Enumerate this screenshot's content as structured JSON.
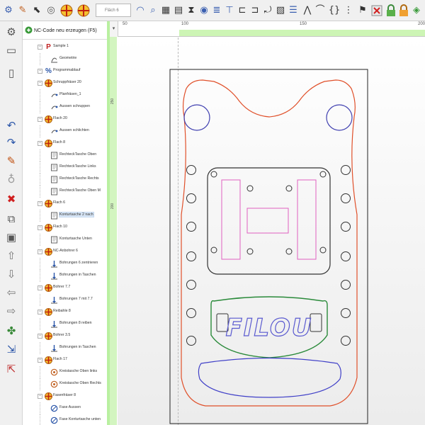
{
  "toolbar": {
    "tool_select_value": "Fläch 6",
    "icons": [
      "gear-magnet-icon",
      "text-edit-icon",
      "cursor-icon",
      "target-icon",
      "origin-cross-icon",
      "tool-select",
      "circle-arc-icon",
      "zoom-icon",
      "grid-icon",
      "pocket-icon",
      "cut-icon",
      "spiral-icon",
      "line-icon",
      "tool-probe-icon",
      "profile-icon",
      "magnet-icon",
      "bend-icon",
      "align-icon",
      "arc-icon",
      "brace-icon",
      "chess-flag-icon",
      "close-cross-icon",
      "lock-green-icon",
      "lock-orange-icon",
      "drop-icon"
    ]
  },
  "tree": {
    "title": "NC-Code neu erzeugen (F5)",
    "rows": [
      {
        "level": 0,
        "icon": "program-icon",
        "label": "Sample 1"
      },
      {
        "level": 1,
        "icon": "geometry-icon",
        "label": "Geometrie"
      },
      {
        "level": 0,
        "icon": "percent-icon",
        "label": "Programmablauf"
      },
      {
        "level": 0,
        "icon": "tool-icon",
        "label": "Schruppfräser 20"
      },
      {
        "level": 1,
        "icon": "op-icon",
        "label": "Planfräsen_1"
      },
      {
        "level": 1,
        "icon": "op-icon",
        "label": "Aussen schruppen"
      },
      {
        "level": 0,
        "icon": "tool-icon",
        "label": "Flach 20"
      },
      {
        "level": 1,
        "icon": "op-icon",
        "label": "Aussen schlichten"
      },
      {
        "level": 0,
        "icon": "tool-icon",
        "label": "Flach 8"
      },
      {
        "level": 1,
        "icon": "page-icon",
        "label": "RechteckTasche Oben"
      },
      {
        "level": 1,
        "icon": "page-icon",
        "label": "RechteckTasche Links"
      },
      {
        "level": 1,
        "icon": "page-icon",
        "label": "RechteckTasche Rechts"
      },
      {
        "level": 1,
        "icon": "page-icon",
        "label": "RechteckTasche Oben M"
      },
      {
        "level": 0,
        "icon": "tool-icon",
        "label": "Flach 6"
      },
      {
        "level": 1,
        "icon": "page-icon",
        "label": "Konturtasche 2 nach"
      },
      {
        "level": 0,
        "icon": "tool-icon",
        "label": "Flach 10"
      },
      {
        "level": 1,
        "icon": "page-icon",
        "label": "Konturtasche Unten"
      },
      {
        "level": 0,
        "icon": "tool-icon",
        "label": "NC-Anbohrer 6"
      },
      {
        "level": 1,
        "icon": "drill-op-icon",
        "label": "Bohrungen 6 zentrieren"
      },
      {
        "level": 1,
        "icon": "drill-op-icon",
        "label": "Bohrungen in Taschen"
      },
      {
        "level": 0,
        "icon": "tool-icon",
        "label": "Bohrer 7.7"
      },
      {
        "level": 1,
        "icon": "drill-op-icon",
        "label": "Bohrungen 7 mit 7.7"
      },
      {
        "level": 0,
        "icon": "tool-icon",
        "label": "Reibahle 8"
      },
      {
        "level": 1,
        "icon": "drill-op-icon",
        "label": "Bohrungen 8 reiben"
      },
      {
        "level": 0,
        "icon": "tool-icon",
        "label": "Bohrer 3.5"
      },
      {
        "level": 1,
        "icon": "drill-op-icon",
        "label": "Bohrungen in Taschen"
      },
      {
        "level": 0,
        "icon": "tool-icon",
        "label": "Flach 17"
      },
      {
        "level": 1,
        "icon": "engrave-op-icon",
        "label": "Kreistasche Oben links"
      },
      {
        "level": 1,
        "icon": "engrave-op-icon",
        "label": "Kreistasche Oben Rechts"
      },
      {
        "level": 0,
        "icon": "tool-icon",
        "label": "Fasenfräser 8"
      },
      {
        "level": 1,
        "icon": "chamfer-op-icon",
        "label": "Fase Aussen"
      },
      {
        "level": 1,
        "icon": "chamfer-op-icon",
        "label": "Fase Konturtasche unten"
      }
    ],
    "selected_index": 14
  },
  "leftbar": {
    "icons": [
      "gear-icon",
      "program-run-icon",
      "undo-icon",
      "redo-icon",
      "pencil-icon",
      "bulb-icon",
      "delete-x-icon",
      "copy-icon",
      "paste-icon",
      "arrow-up-icon",
      "arrow-down-icon",
      "arrow-left-icon",
      "arrow-right-icon",
      "import-icon",
      "export-icon"
    ]
  },
  "ruler": {
    "top_labels": [
      "50",
      "100",
      "150",
      "200"
    ],
    "left_labels": [
      "250",
      "200"
    ],
    "corner_glyph": "▾"
  },
  "drawing": {
    "engraving_text": "FILOU",
    "colors": {
      "outer_contour": "#e0502a",
      "top_circles": "#4040b0",
      "holes": "#333333",
      "side_pockets": "#e060c0",
      "engrave_pocket": "#2a8a3a",
      "engrave_text": "#5a5ad0",
      "bottom_pocket": "#4040c8",
      "stock": "#222222"
    }
  }
}
